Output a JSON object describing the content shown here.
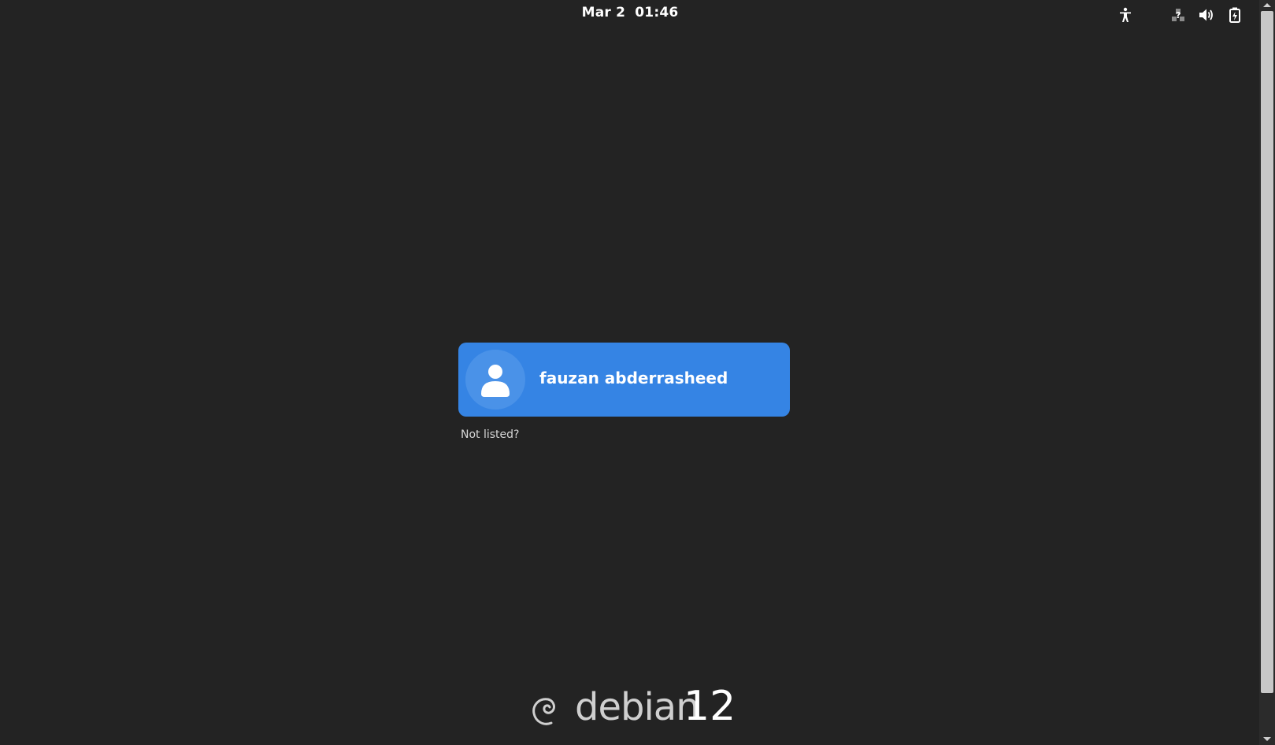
{
  "topbar": {
    "date": "Mar 2",
    "time": "01:46",
    "icons": [
      "accessibility-icon",
      "network-unknown-icon",
      "volume-icon",
      "battery-icon"
    ]
  },
  "login": {
    "users": [
      {
        "name": "fauzan abderrasheed",
        "avatar_icon": "user-silhouette-icon"
      }
    ],
    "not_listed_label": "Not listed?"
  },
  "branding": {
    "name": "debian",
    "version": "12",
    "logo_icon": "debian-swirl-icon"
  },
  "colors": {
    "background": "#232323",
    "accent": "#3584e4",
    "text": "#ffffff"
  }
}
